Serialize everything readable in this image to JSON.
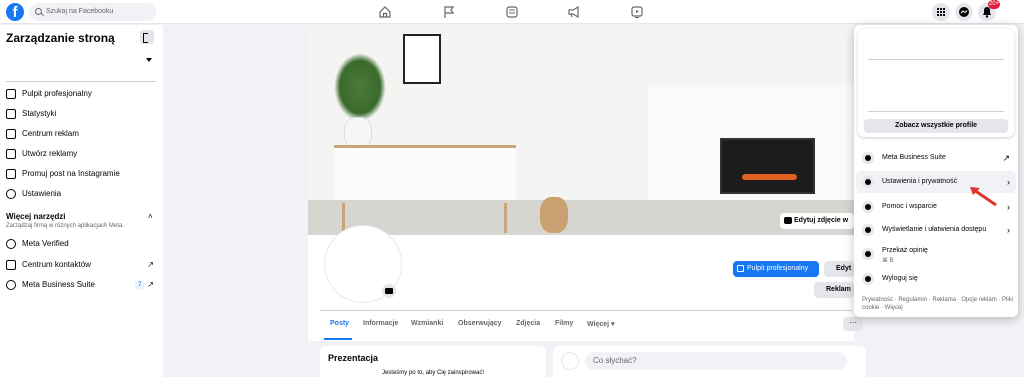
{
  "topbar": {
    "search_placeholder": "Szukaj na Facebooku",
    "logo": "f",
    "nav_icons": [
      "home-icon",
      "flag-icon",
      "marketplace-icon",
      "megaphone-icon",
      "video-icon"
    ],
    "notif_count": "20+"
  },
  "sidebar": {
    "title": "Zarządzanie stroną",
    "items": [
      {
        "label": "Pulpit profesjonalny",
        "icon": "dashboard-icon"
      },
      {
        "label": "Statystyki",
        "icon": "stats-icon"
      },
      {
        "label": "Centrum reklam",
        "icon": "megaphone-icon"
      },
      {
        "label": "Utwórz reklamy",
        "icon": "pencil-icon"
      },
      {
        "label": "Promuj post na Instagramie",
        "icon": "instagram-icon"
      },
      {
        "label": "Ustawienia",
        "icon": "gear-icon"
      }
    ],
    "more_title": "Więcej narzędzi",
    "more_subtitle": "Zarządzaj firmą w różnych aplikacjach Meta.",
    "more_items": [
      {
        "label": "Meta Verified",
        "icon": "verified-icon",
        "ext": ""
      },
      {
        "label": "Centrum kontaktów",
        "icon": "contacts-icon",
        "ext": "↗"
      },
      {
        "label": "Meta Business Suite",
        "icon": "business-suite-icon",
        "ext": "↗",
        "count": "7"
      }
    ]
  },
  "cover": {
    "edit_label": "Edytuj zdjęcie w"
  },
  "page": {
    "btn_professional": "Pulpit profesjonalny",
    "btn_edit": "Edyt",
    "btn_ads": "Reklam",
    "tabs": [
      "Posty",
      "Informacje",
      "Wzmianki",
      "Obserwujący",
      "Zdjęcia",
      "Filmy",
      "Więcej ▾"
    ],
    "tab_more": "···"
  },
  "cards": {
    "intro_title": "Prezentacja",
    "intro_text": "Jesteśmy po to, aby Cię zainspirować!",
    "post_placeholder": "Co słychać?"
  },
  "menu": {
    "see_all": "Zobacz wszystkie profile",
    "items": [
      {
        "label": "Meta Business Suite",
        "arrow": "↗",
        "icon": "business-suite-icon"
      },
      {
        "label": "Ustawienia i prywatność",
        "arrow": "›",
        "icon": "gear-icon"
      },
      {
        "label": "Pomoc i wsparcie",
        "arrow": "›",
        "icon": "help-icon"
      },
      {
        "label": "Wyświetlanie i ułatwienia dostępu",
        "arrow": "›",
        "icon": "moon-icon"
      },
      {
        "label": "Przekaż opinię",
        "arrow": "",
        "icon": "feedback-icon",
        "sub": "⌘ B"
      },
      {
        "label": "Wyloguj się",
        "arrow": "",
        "icon": "logout-icon"
      }
    ],
    "footer": "Prywatność · Regulamin · Reklama · Opcje reklam · Pliki cookie · Więcej"
  },
  "colors": {
    "brand": "#1877f2",
    "alert": "#e41e3f",
    "annotation_arrow": "#e8322e"
  }
}
